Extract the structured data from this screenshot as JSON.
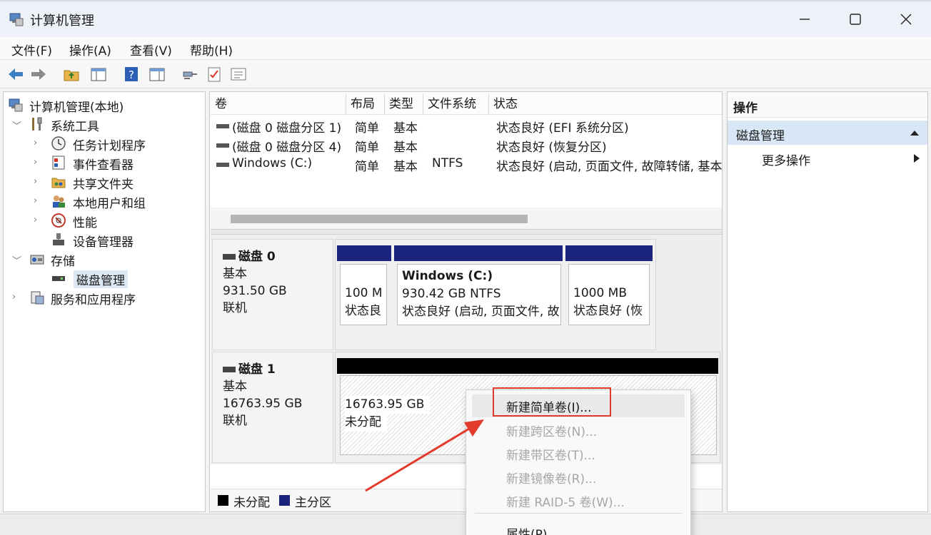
{
  "window": {
    "title": "计算机管理"
  },
  "menu": [
    "文件(F)",
    "操作(A)",
    "查看(V)",
    "帮助(H)"
  ],
  "tree": {
    "root": "计算机管理(本地)",
    "system_tools": "系统工具",
    "task_scheduler": "任务计划程序",
    "event_viewer": "事件查看器",
    "shared_folders": "共享文件夹",
    "local_users": "本地用户和组",
    "performance": "性能",
    "device_manager": "设备管理器",
    "storage": "存储",
    "disk_management": "磁盘管理",
    "services_apps": "服务和应用程序"
  },
  "volume_list": {
    "headers": [
      "卷",
      "布局",
      "类型",
      "文件系统",
      "状态"
    ],
    "rows": [
      {
        "name": "(磁盘 0 磁盘分区 1)",
        "layout": "简单",
        "type": "基本",
        "fs": "",
        "status": "状态良好 (EFI 系统分区)"
      },
      {
        "name": "(磁盘 0 磁盘分区 4)",
        "layout": "简单",
        "type": "基本",
        "fs": "",
        "status": "状态良好 (恢复分区)"
      },
      {
        "name": "Windows (C:)",
        "layout": "简单",
        "type": "基本",
        "fs": "NTFS",
        "status": "状态良好 (启动, 页面文件, 故障转储, 基本"
      }
    ]
  },
  "disks": {
    "disk0": {
      "name": "磁盘 0",
      "type": "基本",
      "size": "931.50 GB",
      "state": "联机",
      "partitions": [
        {
          "line1": "100 M",
          "line2": "状态良"
        },
        {
          "title": "Windows  (C:)",
          "line1": "930.42 GB NTFS",
          "line2": "状态良好 (启动, 页面文件, 故"
        },
        {
          "line1": "1000 MB",
          "line2": "状态良好 (恢"
        }
      ]
    },
    "disk1": {
      "name": "磁盘 1",
      "type": "基本",
      "size": "16763.95 GB",
      "state": "联机",
      "partition": {
        "line1": "16763.95 GB",
        "line2": "未分配"
      }
    }
  },
  "legend": {
    "unallocated": "未分配",
    "primary": "主分区"
  },
  "actions": {
    "header": "操作",
    "section": "磁盘管理",
    "more": "更多操作"
  },
  "context_menu": {
    "items": [
      {
        "label": "新建简单卷(I)...",
        "enabled": true
      },
      {
        "label": "新建跨区卷(N)...",
        "enabled": false
      },
      {
        "label": "新建带区卷(T)...",
        "enabled": false
      },
      {
        "label": "新建镜像卷(R)...",
        "enabled": false
      },
      {
        "label": "新建 RAID-5 卷(W)...",
        "enabled": false
      },
      {
        "label": "属性(P)",
        "enabled": true
      }
    ]
  },
  "colors": {
    "primary_partition": "#1a237e",
    "unallocated": "#000000",
    "highlight": "#e23a2a",
    "selection": "#d8e6f5"
  }
}
